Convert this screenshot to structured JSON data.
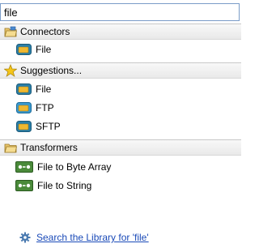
{
  "search": {
    "value": "file"
  },
  "groups": [
    {
      "label": "Connectors",
      "icon": "folder-icon",
      "items": [
        {
          "label": "File",
          "icon": "connector-icon"
        }
      ]
    },
    {
      "label": "Suggestions...",
      "icon": "star-icon",
      "items": [
        {
          "label": "File",
          "icon": "connector-icon"
        },
        {
          "label": "FTP",
          "icon": "connector-icon"
        },
        {
          "label": "SFTP",
          "icon": "connector-icon"
        }
      ]
    },
    {
      "label": "Transformers",
      "icon": "folder-icon",
      "items": [
        {
          "label": "File to Byte Array",
          "icon": "transformer-icon"
        },
        {
          "label": "File to String",
          "icon": "transformer-icon"
        }
      ]
    }
  ],
  "footer": {
    "link_label": "Search the Library for 'file'",
    "icon": "gear-icon"
  },
  "colors": {
    "link": "#1a4ab8",
    "connector_teal": "#2a7fa8",
    "connector_gold": "#f0b830",
    "transformer_green": "#4a8a3a",
    "star_yellow": "#f5c518"
  }
}
